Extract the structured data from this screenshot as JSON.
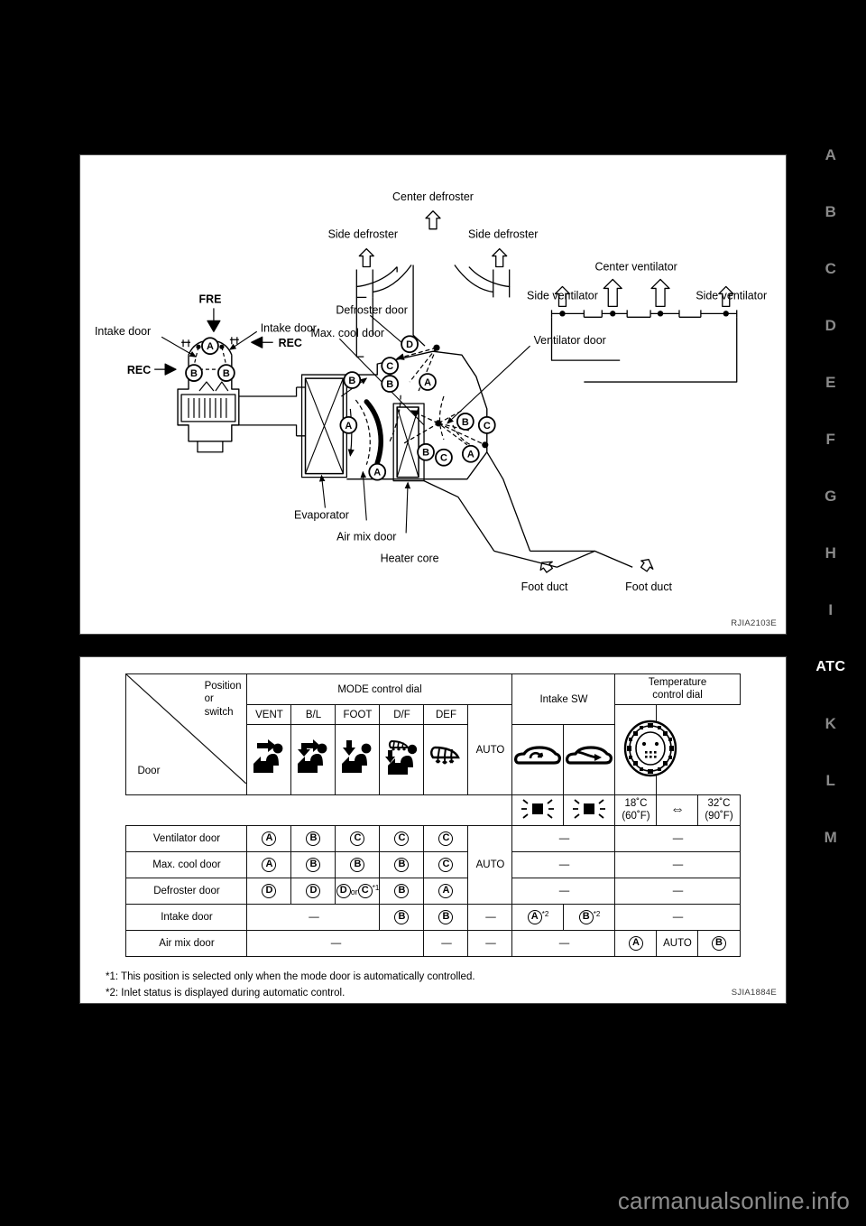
{
  "side_index": {
    "items": [
      {
        "label": "A",
        "active": false
      },
      {
        "label": "B",
        "active": false
      },
      {
        "label": "C",
        "active": false
      },
      {
        "label": "D",
        "active": false
      },
      {
        "label": "E",
        "active": false
      },
      {
        "label": "F",
        "active": false
      },
      {
        "label": "G",
        "active": false
      },
      {
        "label": "H",
        "active": false
      },
      {
        "label": "I",
        "active": false
      },
      {
        "label": "ATC",
        "active": true
      },
      {
        "label": "K",
        "active": false
      },
      {
        "label": "L",
        "active": false
      },
      {
        "label": "M",
        "active": false
      }
    ]
  },
  "figure_airflow": {
    "figure_id": "RJIA2103E",
    "labels": {
      "center_defroster": "Center defroster",
      "side_defroster_left": "Side defroster",
      "side_defroster_right": "Side defroster",
      "center_ventilator": "Center ventilator",
      "side_ventilator_left": "Side ventilator",
      "side_ventilator_right": "Side ventilator",
      "defroster_door": "Defroster door",
      "max_cool_door": "Max. cool door",
      "ventilator_door": "Ventilator door",
      "intake_door_left": "Intake door",
      "intake_door_right": "Intake door",
      "fre": "FRE",
      "rec_left": "REC",
      "rec_right": "REC",
      "evaporator": "Evaporator",
      "air_mix_door": "Air mix door",
      "heater_core": "Heater core",
      "foot_duct_left": "Foot duct",
      "foot_duct_right": "Foot duct"
    },
    "position_markers": [
      "A",
      "B",
      "C",
      "D"
    ]
  },
  "figure_table": {
    "figure_id": "SJIA1884E",
    "corner": {
      "position_or_switch": [
        "Position",
        "or",
        "switch"
      ],
      "door": "Door"
    },
    "group_headers": {
      "mode_control_dial": "MODE control dial",
      "intake_sw": "Intake SW",
      "temperature_control_dial": [
        "Temperature",
        "control dial"
      ]
    },
    "mode_positions": [
      "VENT",
      "B/L",
      "FOOT",
      "D/F",
      "DEF",
      "AUTO"
    ],
    "mode_icons": [
      "vent-icon",
      "bilevel-icon",
      "foot-icon",
      "foot-defrost-icon",
      "defrost-icon",
      "none"
    ],
    "intake_icons": [
      "car-recirculate-icon",
      "car-fresh-air-icon"
    ],
    "intake_lamp_icons": [
      "indicator-lamp-icon",
      "indicator-lamp-icon"
    ],
    "temp_dial_icon": "temperature-dial-icon",
    "temp_range": {
      "cold": [
        "18˚C",
        "(60˚F)"
      ],
      "arrow": "⇔",
      "hot": [
        "32˚C",
        "(90˚F)"
      ]
    },
    "rows": [
      {
        "name": "Ventilator door",
        "vent": "A",
        "bl": "B",
        "foot": "C",
        "df": "C",
        "def": "C",
        "auto": "",
        "intake": "—",
        "temp": "—"
      },
      {
        "name": "Max. cool door",
        "vent": "A",
        "bl": "B",
        "foot": "B",
        "df": "B",
        "def": "C",
        "auto": "AUTO",
        "intake": "—",
        "temp": "—"
      },
      {
        "name": "Defroster door",
        "vent": "D",
        "bl": "D",
        "foot": "D or C",
        "foot_note": "*1",
        "df": "B",
        "def": "A",
        "auto": "",
        "intake": "—",
        "temp": "—"
      },
      {
        "name": "Intake door",
        "vent_bl_foot": "—",
        "df": "B",
        "def": "B",
        "auto": "—",
        "intake_a": "A",
        "intake_a_note": "*2",
        "intake_b": "B",
        "intake_b_note": "*2",
        "temp": "—"
      },
      {
        "name": "Air mix door",
        "vent_bl_foot": "—",
        "df": "—",
        "def": "—",
        "auto": "—",
        "intake": "—",
        "temp_cold": "A",
        "temp_auto": "AUTO",
        "temp_hot": "B"
      }
    ],
    "footnotes": [
      "*1: This position is selected only when the mode door is automatically controlled.",
      "*2: Inlet status is displayed during automatic control."
    ]
  },
  "footer": {
    "watermark": "carmanualsonline.info"
  }
}
